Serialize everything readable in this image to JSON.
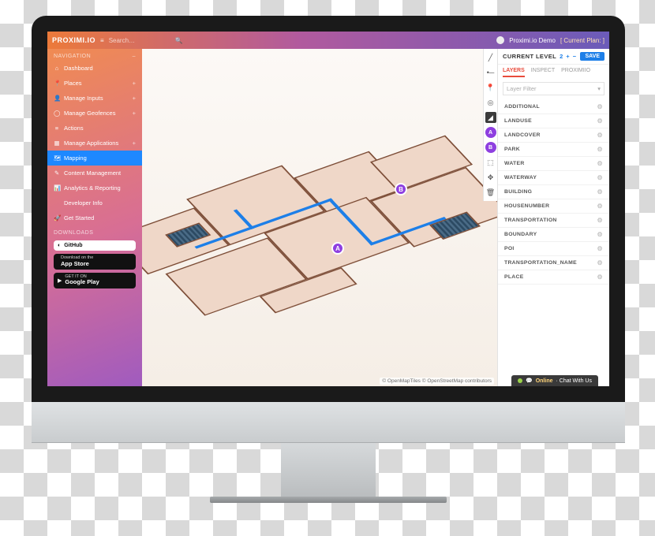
{
  "brand": "PROXIMI.IO",
  "search": {
    "placeholder": "Search…"
  },
  "user": {
    "name": "Proximi.io Demo",
    "plan_link": "[ Current Plan: ]"
  },
  "nav": {
    "section_main": "NAVIGATION",
    "section_downloads": "DOWNLOADS",
    "items": [
      {
        "icon": "⌂",
        "label": "Dashboard",
        "plus": false
      },
      {
        "icon": "📍",
        "label": "Places",
        "plus": true
      },
      {
        "icon": "👤",
        "label": "Manage Inputs",
        "plus": true
      },
      {
        "icon": "◯",
        "label": "Manage Geofences",
        "plus": true
      },
      {
        "icon": "≡",
        "label": "Actions",
        "plus": false
      },
      {
        "icon": "▦",
        "label": "Manage Applications",
        "plus": true
      },
      {
        "icon": "🗺",
        "label": "Mapping",
        "plus": false,
        "active": true
      },
      {
        "icon": "✎",
        "label": "Content Management",
        "plus": false
      },
      {
        "icon": "📊",
        "label": "Analytics & Reporting",
        "plus": false
      },
      {
        "icon": "</>",
        "label": "Developer Info",
        "plus": false
      },
      {
        "icon": "🚀",
        "label": "Get Started",
        "plus": false
      }
    ],
    "badges": {
      "github": {
        "main": "GitHub"
      },
      "appstore": {
        "sub": "Download on the",
        "main": "App Store"
      },
      "play": {
        "sub": "GET IT ON",
        "main": "Google Play"
      }
    }
  },
  "toolstrip": [
    {
      "name": "tool-line",
      "glyph": "╱"
    },
    {
      "name": "tool-node",
      "glyph": "•─"
    },
    {
      "name": "tool-pin",
      "glyph": "📍"
    },
    {
      "name": "tool-target",
      "glyph": "◎"
    },
    {
      "name": "tool-fill",
      "glyph": "◢",
      "dark": true
    },
    {
      "name": "tool-level-a",
      "glyph": "A",
      "purple": true
    },
    {
      "name": "tool-level-b",
      "glyph": "B",
      "purple": true
    },
    {
      "name": "tool-select",
      "glyph": "⬚"
    },
    {
      "name": "tool-move",
      "glyph": "✥"
    },
    {
      "name": "tool-trash",
      "glyph": "🗑"
    }
  ],
  "panel": {
    "level_label": "CURRENT LEVEL",
    "level_value": "2",
    "save": "SAVE",
    "tabs": {
      "layers": "LAYERS",
      "inspect": "INSPECT",
      "proximiio": "PROXIMIIO"
    },
    "filter_placeholder": "Layer Filter",
    "layers": [
      "ADDITIONAL",
      "LANDUSE",
      "LANDCOVER",
      "PARK",
      "WATER",
      "WATERWAY",
      "BUILDING",
      "HOUSENUMBER",
      "TRANSPORTATION",
      "BOUNDARY",
      "POI",
      "TRANSPORTATION_NAME",
      "PLACE"
    ]
  },
  "map": {
    "markers": {
      "a": "A",
      "b": "B"
    },
    "attribution": "© OpenMapTiles © OpenStreetMap contributors"
  },
  "chat": {
    "status": "Online",
    "text": "· Chat With Us"
  }
}
